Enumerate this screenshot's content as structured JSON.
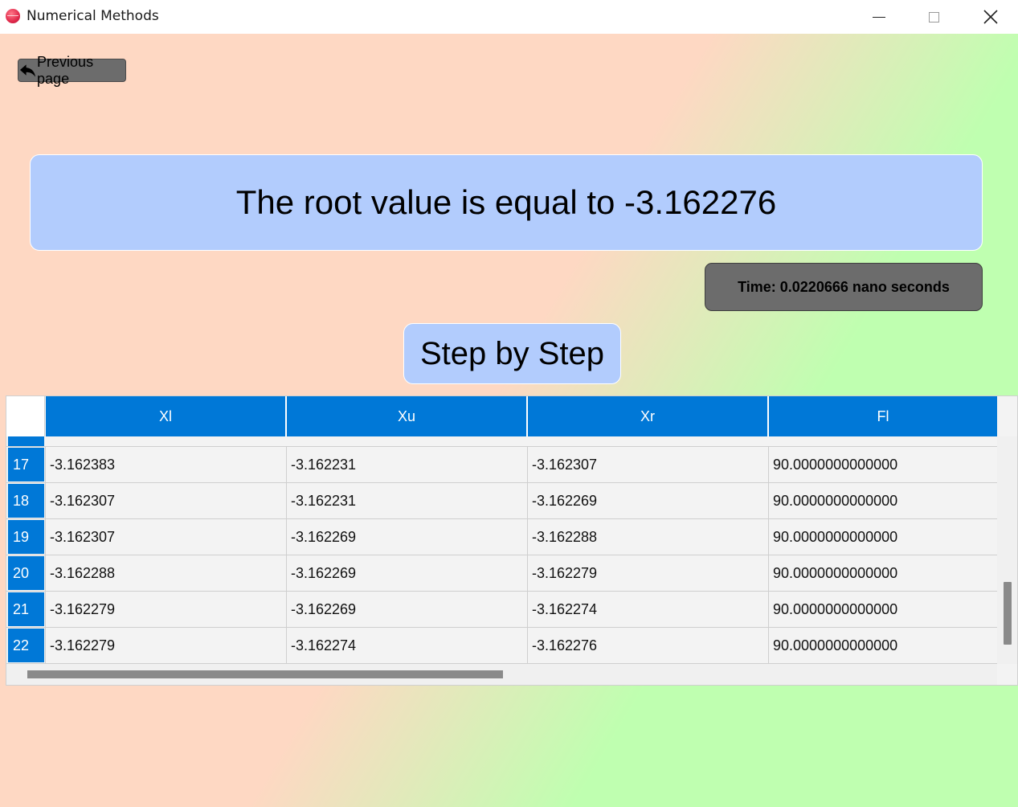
{
  "window": {
    "title": "Numerical Methods",
    "icon": "app-logo-icon"
  },
  "nav": {
    "previous_label": "Previous page",
    "previous_icon": "back-arrow-icon"
  },
  "result": {
    "root_text": "The root value is equal to -3.162276",
    "time_text": "Time: 0.0220666 nano seconds"
  },
  "step_button_label": "Step by Step",
  "table": {
    "columns": [
      "Xl",
      "Xu",
      "Xr",
      "Fl"
    ],
    "rows": [
      {
        "index": "17",
        "cells": [
          "-3.162383",
          "-3.162231",
          "-3.162307",
          "90.0000000000000"
        ]
      },
      {
        "index": "18",
        "cells": [
          "-3.162307",
          "-3.162231",
          "-3.162269",
          "90.0000000000000"
        ]
      },
      {
        "index": "19",
        "cells": [
          "-3.162307",
          "-3.162269",
          "-3.162288",
          "90.0000000000000"
        ]
      },
      {
        "index": "20",
        "cells": [
          "-3.162288",
          "-3.162269",
          "-3.162279",
          "90.0000000000000"
        ]
      },
      {
        "index": "21",
        "cells": [
          "-3.162279",
          "-3.162269",
          "-3.162274",
          "90.0000000000000"
        ]
      },
      {
        "index": "22",
        "cells": [
          "-3.162279",
          "-3.162274",
          "-3.162276",
          "90.0000000000000"
        ]
      }
    ]
  },
  "colors": {
    "header_blue": "#0078d7",
    "panel_blue": "#b2ccfd",
    "dark_button": "#6c6c6c",
    "bg_peach": "#fed8c3",
    "bg_green": "#bfffb0"
  }
}
